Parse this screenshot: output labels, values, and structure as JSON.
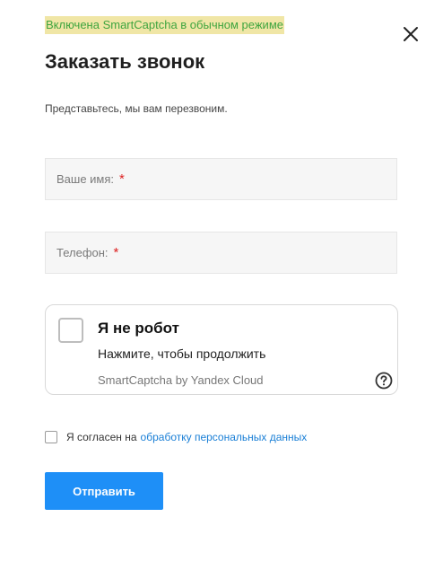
{
  "notice": "Включена SmartCaptcha в обычном режиме",
  "form": {
    "title": "Заказать звонок",
    "subtitle": "Представьтесь, мы вам перезвоним.",
    "fields": [
      {
        "label": "Ваше имя:",
        "required_mark": "*"
      },
      {
        "label": "Телефон:",
        "required_mark": "*"
      }
    ],
    "consent": {
      "text": "Я согласен на",
      "link": "обработку персональных данных",
      "checked": false
    },
    "submit_label": "Отправить"
  },
  "captcha": {
    "title": "Я не робот",
    "hint": "Нажмите, чтобы продолжить",
    "brand": "SmartCaptcha by Yandex Cloud",
    "checked": false
  },
  "icons": {
    "close": "close-icon",
    "help": "question-circle-icon"
  },
  "colors": {
    "accent": "#1e8ff7",
    "link": "#1a7fd6",
    "required": "#dd2222",
    "notice_text": "#3fa53f",
    "notice_background": "#f0e6a6"
  }
}
